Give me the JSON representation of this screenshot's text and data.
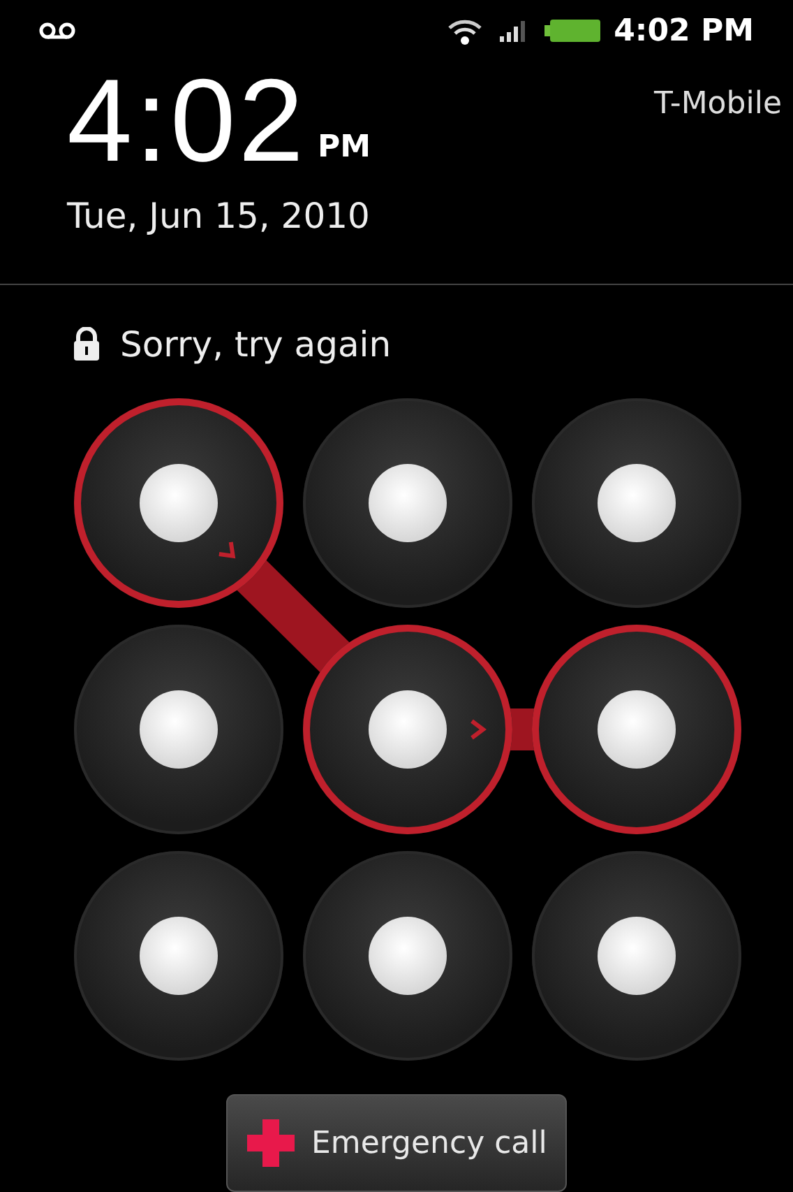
{
  "status_bar": {
    "time": "4:02 PM"
  },
  "clock": {
    "time": "4:02",
    "ampm": "PM",
    "date": "Tue, Jun 15, 2010"
  },
  "carrier": "T-Mobile",
  "message": "Sorry, try again",
  "pattern": {
    "error": true,
    "dots": [
      {
        "selected": true,
        "kind": "southeast"
      },
      {
        "selected": false,
        "kind": "plain"
      },
      {
        "selected": false,
        "kind": "plain"
      },
      {
        "selected": false,
        "kind": "plain"
      },
      {
        "selected": true,
        "kind": "east"
      },
      {
        "selected": true,
        "kind": "plain"
      },
      {
        "selected": false,
        "kind": "plain"
      },
      {
        "selected": false,
        "kind": "plain"
      },
      {
        "selected": false,
        "kind": "plain"
      }
    ]
  },
  "emergency_button": {
    "label": "Emergency call"
  }
}
